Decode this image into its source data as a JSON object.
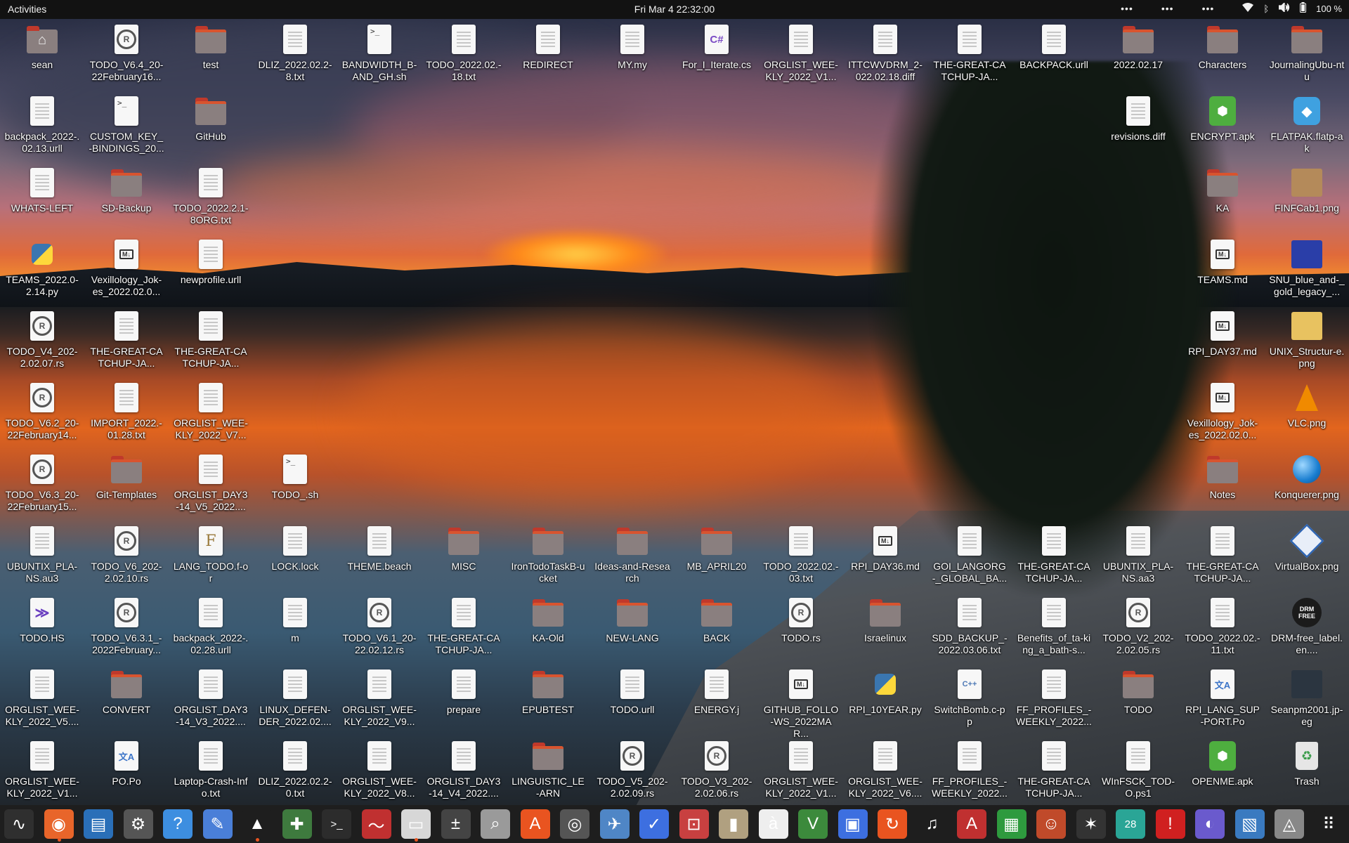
{
  "topbar": {
    "activities": "Activities",
    "clock": "Fri Mar 4  22:32:00",
    "overflow1": "•••",
    "overflow2": "•••",
    "overflow3": "•••",
    "battery": "100 %"
  },
  "desktop_icons": [
    {
      "label": "sean",
      "kind": "home"
    },
    {
      "label": "TODO_V6.4_20-22February16...",
      "kind": "rust"
    },
    {
      "label": "test",
      "kind": "folder"
    },
    {
      "label": "DLIZ_2022.02.2-8.txt",
      "kind": "doc"
    },
    {
      "label": "BANDWIDTH_B-AND_GH.sh",
      "kind": "term"
    },
    {
      "label": "TODO_2022.02.-18.txt",
      "kind": "doc"
    },
    {
      "label": "REDIRECT",
      "kind": "doc"
    },
    {
      "label": "MY.my",
      "kind": "doc"
    },
    {
      "label": "For_I_Iterate.cs",
      "kind": "cs"
    },
    {
      "label": "ORGLIST_WEE-KLY_2022_V1...",
      "kind": "doc"
    },
    {
      "label": "ITTCWVDRM_2-022.02.18.diff",
      "kind": "doc"
    },
    {
      "label": "THE-GREAT-CATCHUP-JA...",
      "kind": "doc"
    },
    {
      "label": "BACKPACK.urll",
      "kind": "doc"
    },
    {
      "label": "2022.02.17",
      "kind": "folder"
    },
    {
      "label": "Characters",
      "kind": "folder"
    },
    {
      "label": "JournalingUbu-ntu",
      "kind": "folder"
    },
    {
      "label": "backpack_2022-.02.13.urll",
      "kind": "doc"
    },
    {
      "label": "CUSTOM_KEY_-BINDINGS_20...",
      "kind": "term"
    },
    {
      "label": "GitHub",
      "kind": "folder"
    },
    {
      "label": "revisions.diff",
      "kind": "doc"
    },
    {
      "label": "ENCRYPT.apk",
      "kind": "apk"
    },
    {
      "label": "FLATPAK.flatp-ak",
      "kind": "flat"
    },
    {
      "label": "WHATS-LEFT",
      "kind": "doc"
    },
    {
      "label": "SD-Backup",
      "kind": "folder"
    },
    {
      "label": "TODO_2022.2.1-8ORG.txt",
      "kind": "doc"
    },
    {
      "label": "KA",
      "kind": "folder"
    },
    {
      "label": "FINFCab1.png",
      "kind": "img",
      "color": "#b48a5a"
    },
    {
      "label": "TEAMS_2022.0-2.14.py",
      "kind": "py"
    },
    {
      "label": "Vexillology_Jok-es_2022.02.0...",
      "kind": "md"
    },
    {
      "label": "newprofile.urll",
      "kind": "doc"
    },
    {
      "label": "TEAMS.md",
      "kind": "md"
    },
    {
      "label": "SNU_blue_and-_gold_legacy_...",
      "kind": "img",
      "color": "#2a3ea8"
    },
    {
      "label": "TODO_V4_202-2.02.07.rs",
      "kind": "rust"
    },
    {
      "label": "THE-GREAT-CATCHUP-JA...",
      "kind": "doc"
    },
    {
      "label": "THE-GREAT-CATCHUP-JA...",
      "kind": "doc"
    },
    {
      "label": "RPI_DAY37.md",
      "kind": "md"
    },
    {
      "label": "UNIX_Structur-e.png",
      "kind": "img",
      "color": "#e8c260"
    },
    {
      "label": "TODO_V6.2_20-22February14...",
      "kind": "rust"
    },
    {
      "label": "IMPORT_2022.-01.28.txt",
      "kind": "doc"
    },
    {
      "label": "ORGLIST_WEE-KLY_2022_V7...",
      "kind": "doc"
    },
    {
      "label": "Vexillology_Jok-es_2022.02.0...",
      "kind": "md"
    },
    {
      "label": "VLC.png",
      "kind": "vlc"
    },
    {
      "label": "TODO_V6.3_20-22February15...",
      "kind": "rust"
    },
    {
      "label": "Git-Templates",
      "kind": "folder"
    },
    {
      "label": "ORGLIST_DAY3-14_V5_2022....",
      "kind": "doc"
    },
    {
      "label": "TODO_.sh",
      "kind": "term"
    },
    {
      "label": "Notes",
      "kind": "folder"
    },
    {
      "label": "Konquerer.png",
      "kind": "konq"
    },
    {
      "label": "UBUNTIX_PLA-NS.au3",
      "kind": "doc"
    },
    {
      "label": "TODO_V6_202-2.02.10.rs",
      "kind": "rust"
    },
    {
      "label": "LANG_TODO.f-or",
      "kind": "f"
    },
    {
      "label": "LOCK.lock",
      "kind": "doc"
    },
    {
      "label": "THEME.beach",
      "kind": "doc"
    },
    {
      "label": "MISC",
      "kind": "folder"
    },
    {
      "label": "IronTodoTaskB-ucket",
      "kind": "folder"
    },
    {
      "label": "Ideas-and-Research",
      "kind": "folder"
    },
    {
      "label": "MB_APRIL20",
      "kind": "folder"
    },
    {
      "label": "TODO_2022.02.-03.txt",
      "kind": "doc"
    },
    {
      "label": "RPI_DAY36.md",
      "kind": "md"
    },
    {
      "label": "GOI_LANGORG-_GLOBAL_BA...",
      "kind": "doc"
    },
    {
      "label": "THE-GREAT-CATCHUP-JA...",
      "kind": "doc"
    },
    {
      "label": "UBUNTIX_PLA-NS.aa3",
      "kind": "doc"
    },
    {
      "label": "THE-GREAT-CATCHUP-JA...",
      "kind": "doc"
    },
    {
      "label": "VirtualBox.png",
      "kind": "vbox"
    },
    {
      "label": "TODO.HS",
      "kind": "hs"
    },
    {
      "label": "TODO_V6.3.1_-2022February...",
      "kind": "rust"
    },
    {
      "label": "backpack_2022-.02.28.urll",
      "kind": "doc"
    },
    {
      "label": "m",
      "kind": "doc"
    },
    {
      "label": "TODO_V6.1_20-22.02.12.rs",
      "kind": "rust"
    },
    {
      "label": "THE-GREAT-CATCHUP-JA...",
      "kind": "doc"
    },
    {
      "label": "KA-Old",
      "kind": "folder"
    },
    {
      "label": "NEW-LANG",
      "kind": "folder"
    },
    {
      "label": "BACK",
      "kind": "folder"
    },
    {
      "label": "TODO.rs",
      "kind": "rust"
    },
    {
      "label": "Israelinux",
      "kind": "folder"
    },
    {
      "label": "SDD_BACKUP_-2022.03.06.txt",
      "kind": "doc"
    },
    {
      "label": "Benefits_of_ta-king_a_bath-s...",
      "kind": "doc"
    },
    {
      "label": "TODO_V2_202-2.02.05.rs",
      "kind": "rust"
    },
    {
      "label": "TODO_2022.02.-11.txt",
      "kind": "doc"
    },
    {
      "label": "DRM-free_label.en....",
      "kind": "drm"
    },
    {
      "label": "ORGLIST_WEE-KLY_2022_V5....",
      "kind": "doc"
    },
    {
      "label": "CONVERT",
      "kind": "folder"
    },
    {
      "label": "ORGLIST_DAY3-14_V3_2022....",
      "kind": "doc"
    },
    {
      "label": "LINUX_DEFEN-DER_2022.02....",
      "kind": "doc"
    },
    {
      "label": "ORGLIST_WEE-KLY_2022_V9...",
      "kind": "doc"
    },
    {
      "label": "prepare",
      "kind": "doc"
    },
    {
      "label": "EPUBTEST",
      "kind": "folder"
    },
    {
      "label": "TODO.urll",
      "kind": "doc"
    },
    {
      "label": "ENERGY.j",
      "kind": "doc"
    },
    {
      "label": "GITHUB_FOLLO-WS_2022MAR...",
      "kind": "md"
    },
    {
      "label": "RPI_10YEAR.py",
      "kind": "py"
    },
    {
      "label": "SwitchBomb.c-pp",
      "kind": "cpp"
    },
    {
      "label": "FF_PROFILES_-WEEKLY_2022...",
      "kind": "doc"
    },
    {
      "label": "TODO",
      "kind": "folder"
    },
    {
      "label": "RPI_LANG_SUP-PORT.Po",
      "kind": "po"
    },
    {
      "label": "Seanpm2001.jp-eg",
      "kind": "img",
      "color": "#2b3540"
    },
    {
      "label": "ORGLIST_WEE-KLY_2022_V1...",
      "kind": "doc"
    },
    {
      "label": "PO.Po",
      "kind": "po"
    },
    {
      "label": "Laptop-Crash-Info.txt",
      "kind": "doc"
    },
    {
      "label": "DLIZ_2022.02.2-0.txt",
      "kind": "doc"
    },
    {
      "label": "ORGLIST_WEE-KLY_2022_V8...",
      "kind": "doc"
    },
    {
      "label": "ORGLIST_DAY3-14_V4_2022....",
      "kind": "doc"
    },
    {
      "label": "LINGUISTIC_LE-ARN",
      "kind": "folder"
    },
    {
      "label": "TODO_V5_202-2.02.09.rs",
      "kind": "rust"
    },
    {
      "label": "TODO_V3_202-2.02.06.rs",
      "kind": "rust"
    },
    {
      "label": "ORGLIST_WEE-KLY_2022_V1...",
      "kind": "doc"
    },
    {
      "label": "ORGLIST_WEE-KLY_2022_V6....",
      "kind": "doc"
    },
    {
      "label": "FF_PROFILES_-WEEKLY_2022...",
      "kind": "doc"
    },
    {
      "label": "THE-GREAT-CATCHUP-JA...",
      "kind": "doc"
    },
    {
      "label": "WInFSCK_TOD-O.ps1",
      "kind": "doc"
    },
    {
      "label": "OPENME.apk",
      "kind": "apk"
    },
    {
      "label": "Trash",
      "kind": "trash"
    }
  ],
  "dock": [
    {
      "name": "system-monitor",
      "glyph": "∿",
      "bg": "#2f2f2f",
      "running": false
    },
    {
      "name": "firefox",
      "glyph": "◉",
      "bg": "#e8652a",
      "running": true
    },
    {
      "name": "libreoffice-writer",
      "glyph": "▤",
      "bg": "#2a6fb8",
      "running": false
    },
    {
      "name": "settings",
      "glyph": "⚙",
      "bg": "#555555",
      "running": false
    },
    {
      "name": "help",
      "glyph": "?",
      "bg": "#3d8ee0",
      "running": false
    },
    {
      "name": "text-editor",
      "glyph": "✎",
      "bg": "#4a7fd8",
      "running": false
    },
    {
      "name": "vlc",
      "glyph": "▲",
      "bg": "#1e1e1e",
      "running": true
    },
    {
      "name": "minesweeper",
      "glyph": "✚",
      "bg": "#3e7a3e",
      "running": false
    },
    {
      "name": "terminal",
      "glyph": ">_",
      "bg": "#2c2c2c",
      "running": false
    },
    {
      "name": "resources",
      "glyph": "〜",
      "bg": "#c03030",
      "running": false
    },
    {
      "name": "files",
      "glyph": "▭",
      "bg": "#d7d7d7",
      "running": true
    },
    {
      "name": "calculator",
      "glyph": "±",
      "bg": "#444444",
      "running": false
    },
    {
      "name": "image-viewer",
      "glyph": "⌕",
      "bg": "#9a9a9a",
      "running": false
    },
    {
      "name": "software",
      "glyph": "A",
      "bg": "#e95420",
      "running": false
    },
    {
      "name": "disks",
      "glyph": "◎",
      "bg": "#555555",
      "running": false
    },
    {
      "name": "shotwell",
      "glyph": "✈",
      "bg": "#4f86c6",
      "running": false
    },
    {
      "name": "todo",
      "glyph": "✓",
      "bg": "#3d6fe0",
      "running": false
    },
    {
      "name": "screenshot",
      "glyph": "⊡",
      "bg": "#c84040",
      "running": false
    },
    {
      "name": "archive-manager",
      "glyph": "▮",
      "bg": "#b0a080",
      "running": false
    },
    {
      "name": "character-map",
      "glyph": "à",
      "bg": "#eeeeee",
      "running": false
    },
    {
      "name": "vim",
      "glyph": "V",
      "bg": "#3c8a3c",
      "running": false
    },
    {
      "name": "workspaces",
      "glyph": "▣",
      "bg": "#3d6fe0",
      "running": false
    },
    {
      "name": "update-manager",
      "glyph": "↻",
      "bg": "#e95420",
      "running": false
    },
    {
      "name": "rhythmbox",
      "glyph": "♫",
      "bg": "#1e1e1e",
      "running": false
    },
    {
      "name": "document-viewer",
      "glyph": "A",
      "bg": "#c03030",
      "running": false
    },
    {
      "name": "spreadsheet",
      "glyph": "▦",
      "bg": "#2e9a3e",
      "running": false
    },
    {
      "name": "supertux",
      "glyph": "☺",
      "bg": "#c04a2a",
      "running": false
    },
    {
      "name": "cheese",
      "glyph": "✶",
      "bg": "#333333",
      "running": false
    },
    {
      "name": "calendar",
      "glyph": "28",
      "bg": "#2aa596",
      "running": false
    },
    {
      "name": "error-reporter",
      "glyph": "!",
      "bg": "#d02020",
      "running": false
    },
    {
      "name": "camera",
      "glyph": "◐",
      "bg": "#6a5acd",
      "running": false
    },
    {
      "name": "remote-desktop",
      "glyph": "▧",
      "bg": "#3a7ac0",
      "running": false
    },
    {
      "name": "app-center",
      "glyph": "◬",
      "bg": "#888888",
      "running": false
    },
    {
      "name": "show-apps",
      "glyph": "⠿",
      "bg": "#1e1e1e",
      "running": false
    }
  ]
}
